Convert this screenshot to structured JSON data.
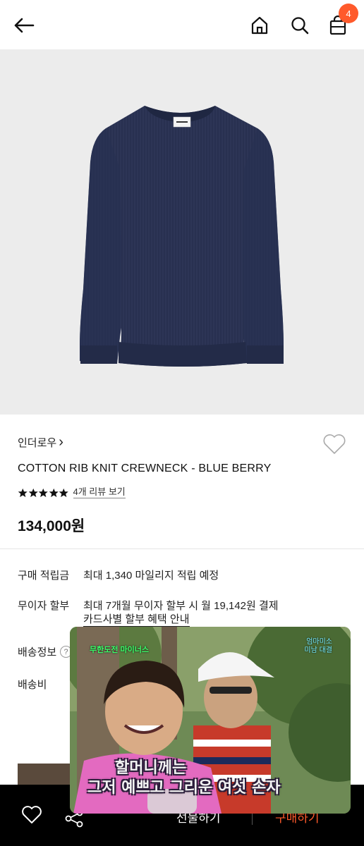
{
  "header": {
    "cart_count": "4",
    "icons": [
      "back-arrow-icon",
      "home-icon",
      "search-icon",
      "cart-bag-icon"
    ]
  },
  "product": {
    "brand": "인더로우",
    "brand_chevron": "›",
    "title": "COTTON RIB KNIT CREWNECK - BLUE BERRY",
    "rating_stars": 5,
    "review_link": "4개 리뷰 보기",
    "price": "134,000원",
    "image_color": "#2d3556"
  },
  "info": {
    "points_label": "구매 적립금",
    "points_value": "최대 1,340 마일리지 적립 예정",
    "installment_label": "무이자 할부",
    "installment_value": "최대 7개월 무이자 할부 시 월 19,142원 결제",
    "card_benefit_link": "카드사별 할부 혜택 안내",
    "shipping_info_label": "배송정보",
    "shipping_help": "?",
    "shipping_fee_label": "배송비"
  },
  "bottom_bar": {
    "gift_label": "선물하기",
    "buy_label": "구매하기",
    "accent": "#ff5a2b"
  },
  "video_overlay": {
    "subtitle_line1": "할머니께는",
    "subtitle_line2": "그저 예쁘고 그리운 여섯 손자",
    "channel_tag": "무한도전 마이너스",
    "corner_tag_line1": "엄마미소",
    "corner_tag_line2": "미남 대결"
  }
}
